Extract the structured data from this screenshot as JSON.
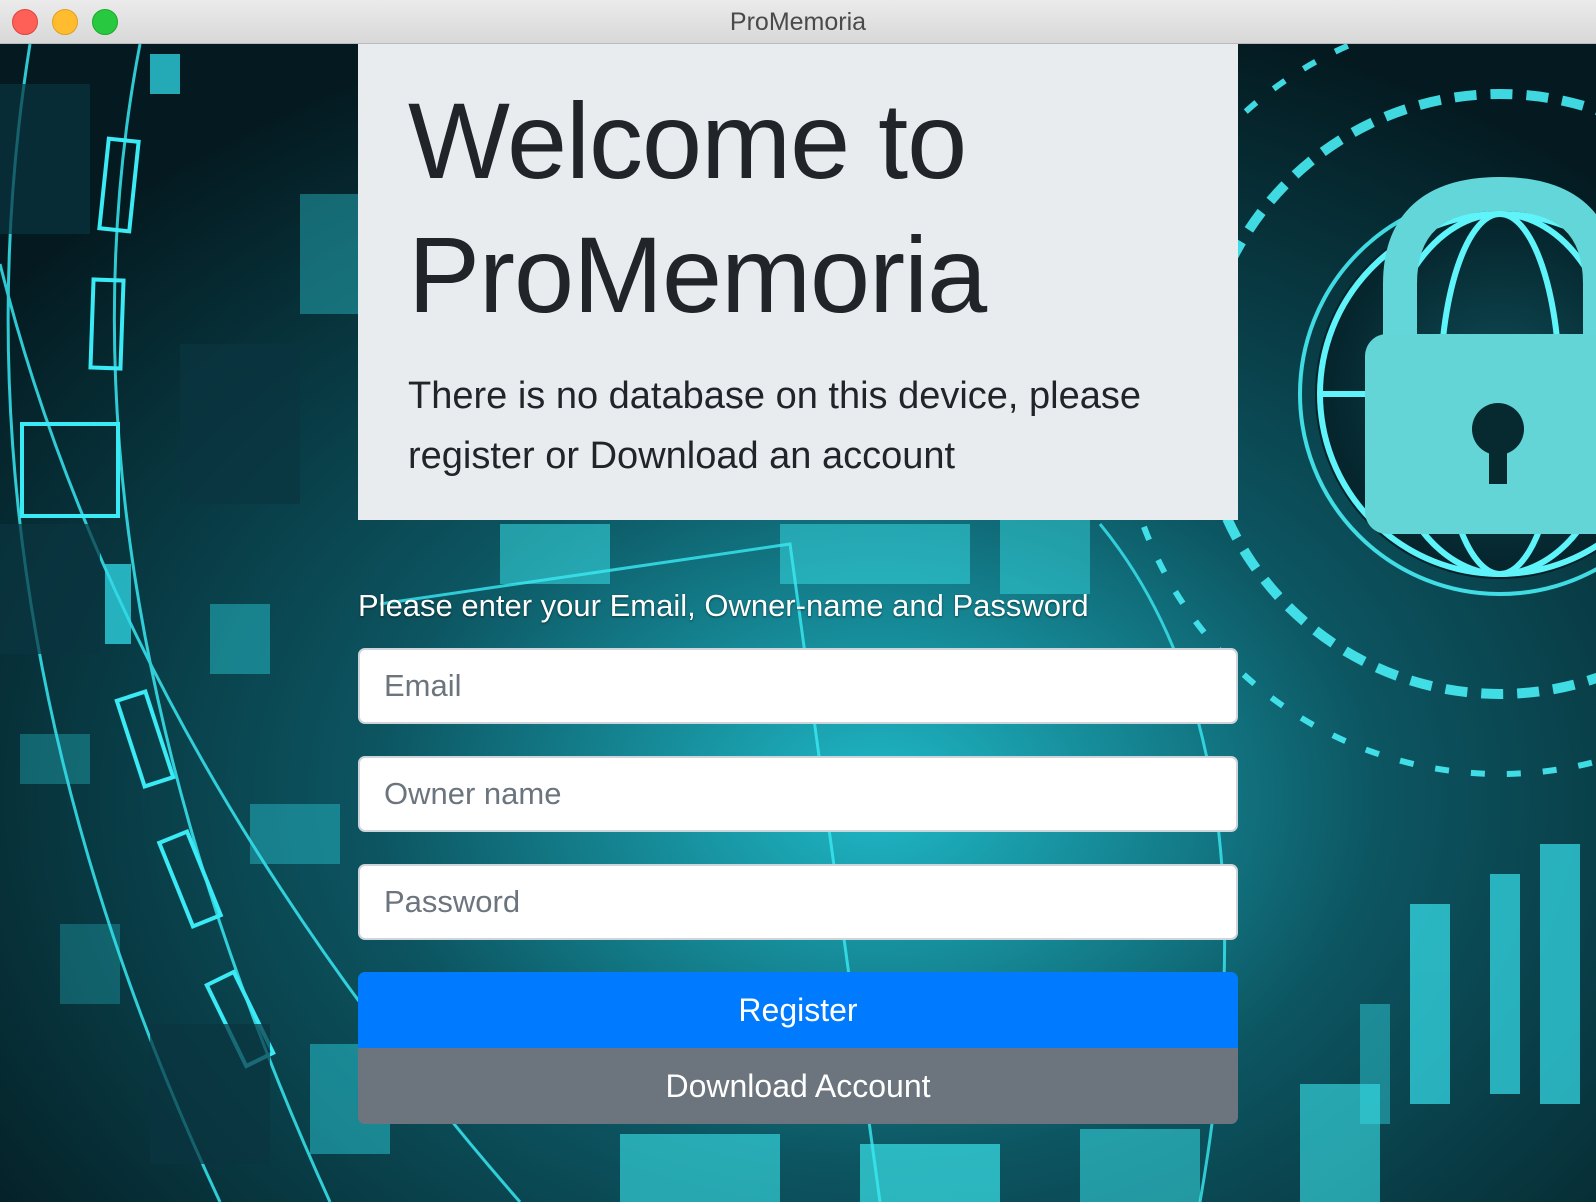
{
  "window": {
    "title": "ProMemoria"
  },
  "jumbotron": {
    "title": "Welcome to ProMemoria",
    "lead": "There is no database on this device, please register or Download an account"
  },
  "form": {
    "prompt": "Please enter your Email, Owner-name and Password",
    "email_placeholder": "Email",
    "owner_placeholder": "Owner name",
    "password_placeholder": "Password",
    "register_label": "Register",
    "download_label": "Download Account"
  },
  "colors": {
    "primary": "#007bff",
    "secondary": "#6c757d",
    "jumbotron_bg": "#e9ecef",
    "background_accent": "#33e6f0",
    "background_dark": "#07252c"
  },
  "background": {
    "icon": "padlock-globe-icon"
  }
}
